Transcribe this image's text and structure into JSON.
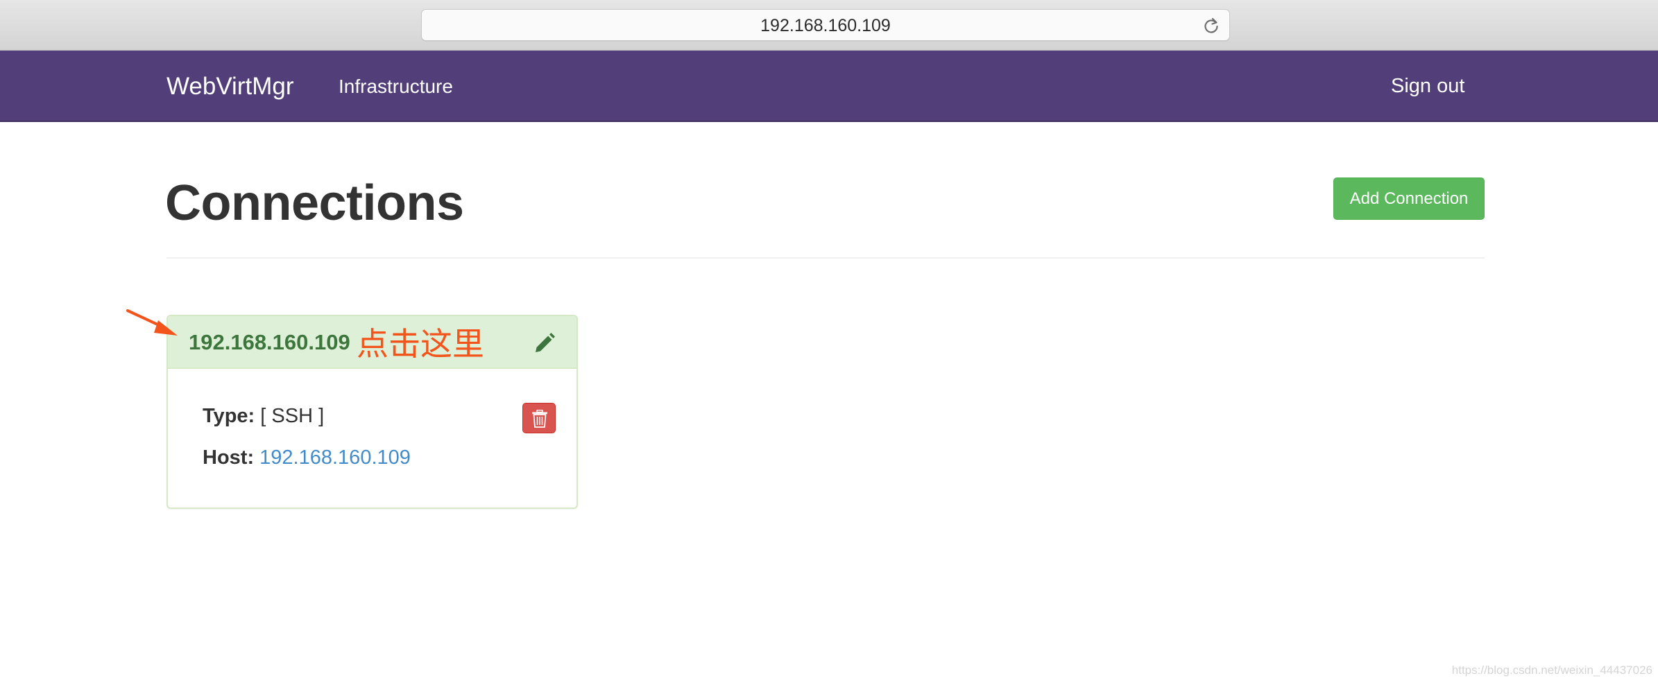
{
  "browser": {
    "address": "192.168.160.109"
  },
  "navbar": {
    "brand": "WebVirtMgr",
    "infrastructure_label": "Infrastructure",
    "signout_label": "Sign out",
    "background_color": "#523f79"
  },
  "page": {
    "title": "Connections",
    "add_connection_label": "Add Connection"
  },
  "connections": [
    {
      "title": "192.168.160.109",
      "type_label": "Type:",
      "type_value": "[ SSH ]",
      "host_label": "Host:",
      "host_value": "192.168.160.109",
      "edit_icon": "pencil-icon",
      "delete_icon": "trash-icon"
    }
  ],
  "annotation": {
    "text": "点击这里",
    "color": "#f2541b",
    "arrow_icon": "arrow-icon"
  },
  "watermark": "https://blog.csdn.net/weixin_44437026"
}
